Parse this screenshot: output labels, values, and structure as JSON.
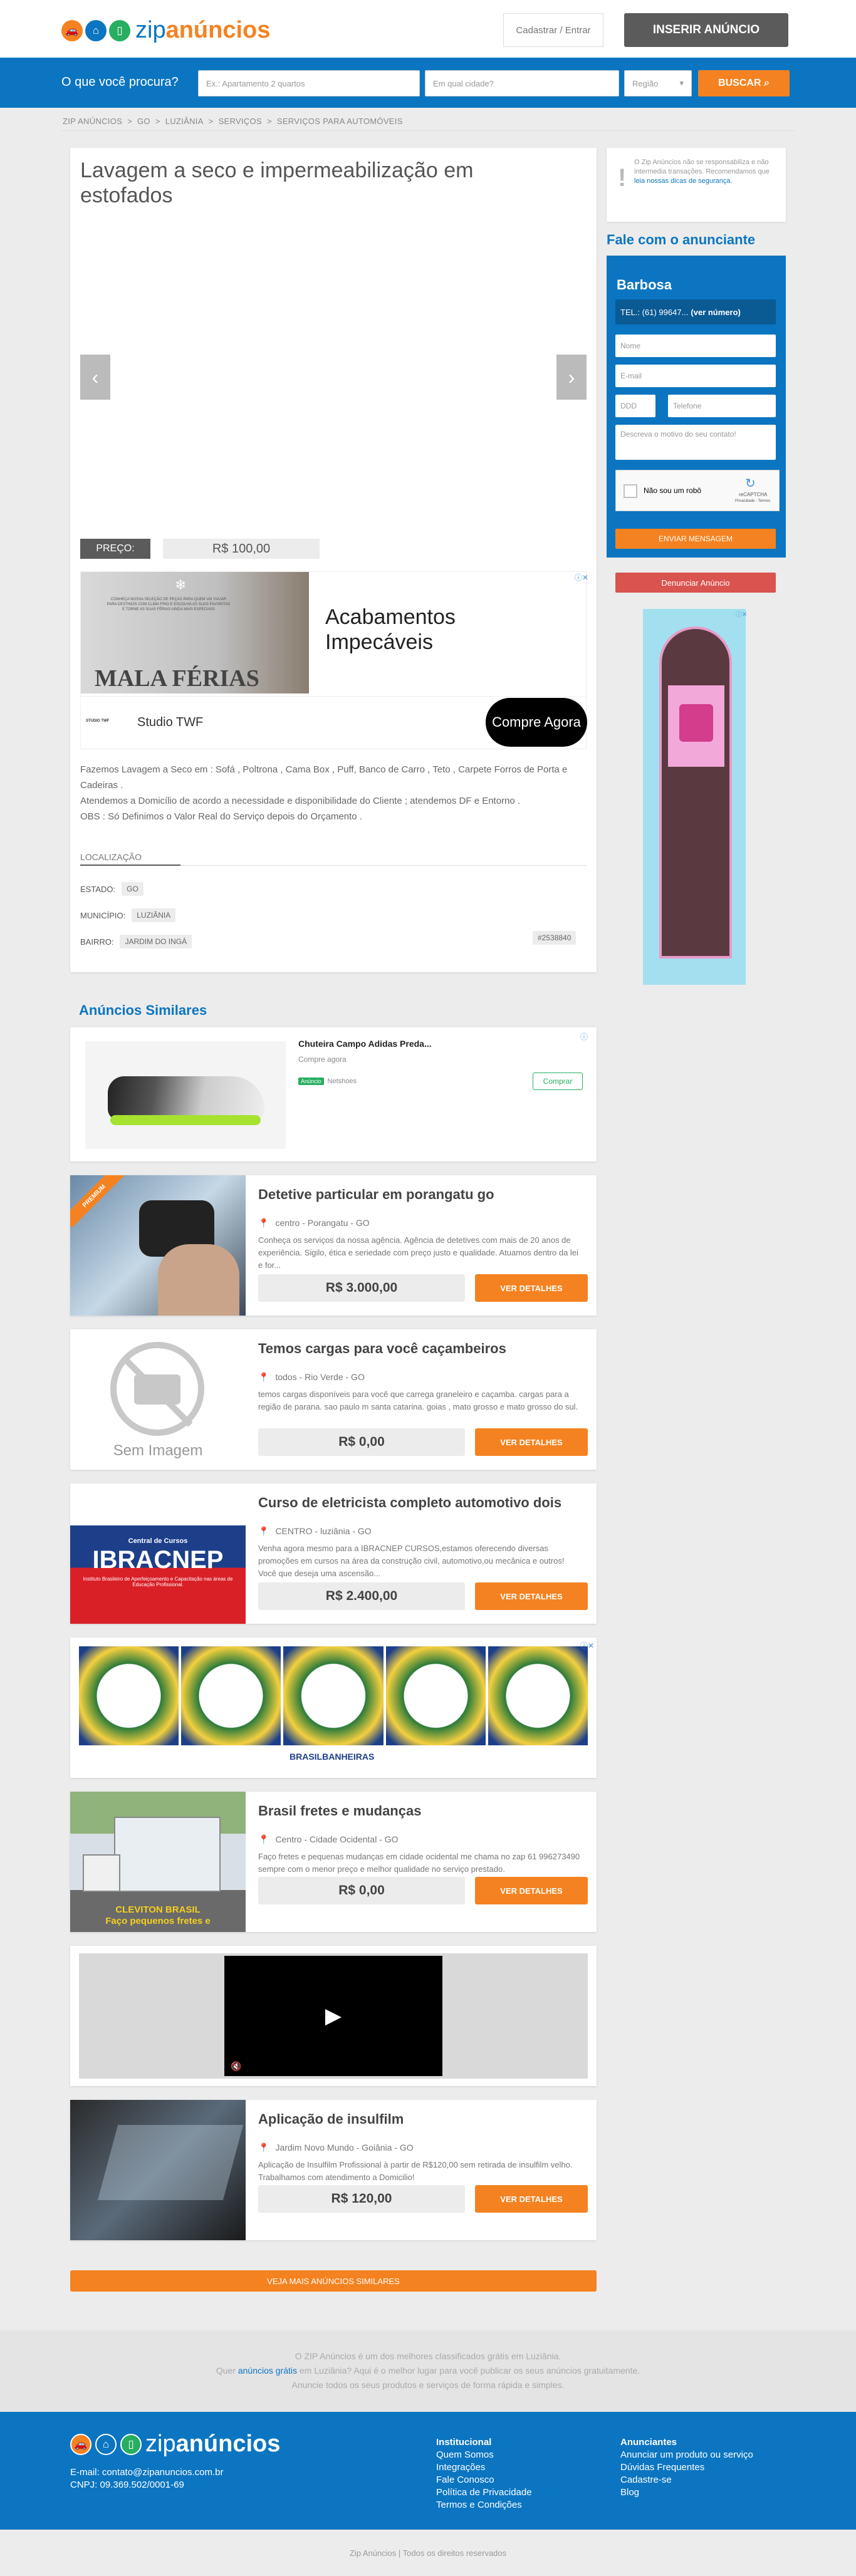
{
  "header": {
    "logo_text_a": "zip",
    "logo_text_b": "anúncios",
    "login": "Cadastrar / Entrar",
    "insert": "INSERIR ANÚNCIO"
  },
  "search": {
    "label": "O que você procura?",
    "query_placeholder": "Ex.: Apartamento 2 quartos",
    "city_placeholder": "Em qual cidade?",
    "region": "Região",
    "button": "BUSCAR"
  },
  "breadcrumb": [
    "ZIP ANÚNCIOS",
    ">",
    "GO",
    ">",
    "LUZIÂNIA",
    ">",
    "SERVIÇOS",
    ">",
    "SERVIÇOS PARA AUTOMÓVEIS"
  ],
  "listing": {
    "title": "Lavagem a seco e impermeabilização em estofados",
    "price_label": "PREÇO:",
    "price": "R$ 100,00",
    "desc": [
      "Fazemos Lavagem a Seco em : Sofá , Poltrona , Cama Box , Puff, Banco de Carro , Teto , Carpete Forros de Porta e Cadeiras .",
      "Atendemos a Domicílio de acordo a necessidade e disponibilidade do Cliente ; atendemos DF e Entorno .",
      "OBS : Só Definimos o Valor Real do Serviço depois do Orçamento ."
    ],
    "location_title": "LOCALIZAÇÃO",
    "estado_label": "ESTADO:",
    "estado": "GO",
    "municipio_label": "MUNICÍPIO:",
    "municipio": "LUZIÂNIA",
    "bairro_label": "BAIRRO:",
    "bairro": "JARDIM DO INGÁ",
    "code": "#2538840"
  },
  "ad1": {
    "big": "Acabamentos Impecáveis",
    "brand": "Studio TWF",
    "cta": "Compre Agora",
    "banner": "MALA FÉRIAS",
    "small": "CONHEÇA NOSSA SELEÇÃO DE PEÇAS PARA QUEM VAI VIAJAR PARA DESTINOS COM CLIMA FRIO E ESCOLHA AS SUAS FAVORITAS E TORNE AS SUAS FÉRIAS AINDA MAIS ESPECIAIS!",
    "logo": "STUDIO TWF"
  },
  "sidebar": {
    "notice_a": "O Zip Anúncios não se responsabiliza e não intermedia transações. Recomendamos que ",
    "notice_link": "leia nossas dicas de segurança",
    "notice_b": ".",
    "contact_title": "Fale com o anunciante",
    "seller": "Barbosa",
    "phone": "TEL.: (61) 99647...",
    "phone_more": "(ver número)",
    "name_ph": "Nome",
    "email_ph": "E-mail",
    "ddd_ph": "DDD",
    "tel_ph": "Telefone",
    "msg_ph": "Descreva o motivo do seu contato!",
    "robot": "Não sou um robô",
    "recaptcha": "reCAPTCHA",
    "recaptcha_sub": "Privacidade - Termos",
    "send": "ENVIAR MENSAGEM",
    "report": "Denunciar Anúncio"
  },
  "similar": {
    "title": "Anúncios Similares",
    "ad_shoe": {
      "title": "Chuteira Campo Adidas Preda...",
      "sub": "Compre agora",
      "badge": "Anúncio",
      "store": "Netshoes",
      "btn": "Comprar"
    },
    "items": [
      {
        "title": "Detetive particular em porangatu go",
        "loc": "centro - Porangatu - GO",
        "desc": "Conheça os serviços da nossa agência. Agência de detetives com mais de 20 anos de experiência. Sigilo, ética e seriedade com preço justo e qualidade. Atuamos dentro da lei e for...",
        "price": "R$ 3.000,00",
        "btn": "VER DETALHES",
        "ribbon": "PREMIUM"
      },
      {
        "title": "Temos cargas para você caçambeiros",
        "loc": "todos - Rio Verde - GO",
        "desc": "temos cargas disponíveis para você que carrega graneleiro e caçamba. cargas para a região de parana. sao paulo m santa catarina. goias , mato grosso e mato grosso do sul.",
        "price": "R$ 0,00",
        "btn": "VER DETALHES",
        "noimg": "Sem Imagem"
      },
      {
        "title": "Curso de eletricista completo automotivo dois",
        "loc": "CENTRO - luziânia - GO",
        "desc": "Venha agora mesmo para a IBRACNEP CURSOS,estamos oferecendo diversas promoções em cursos na área da construção civil, automotivo,ou mecânica e outros! Você que deseja uma ascensão...",
        "price": "R$ 2.400,00",
        "btn": "VER DETALHES",
        "img_top": "Central de Cursos",
        "img_big": "IBRACNEP",
        "img_sub": "Instituto Brasileiro de Aperfeiçoamento e Capacitação nas áreas de Educação Profissional."
      },
      {
        "title": "Brasil fretes e mudanças",
        "loc": "Centro - Cidade Ocidental - GO",
        "desc": "Faço fretes e pequenas mudanças em cidade ocidental me chama no zap 61 996273490 sempre com o menor preço e melhor qualidade no serviço prestado.",
        "price": "R$ 0,00",
        "btn": "VER DETALHES",
        "img_a": "CLEVITON BRASIL",
        "img_b": "Faço pequenos fretes e"
      },
      {
        "title": "Aplicação de insulfilm",
        "loc": "Jardim Novo Mundo - Goiânia - GO",
        "desc": "Aplicação de Insulfilm Profissional à partir de R$120,00 sem retirada de insulfilm velho. Trabalhamos com atendimento a Domicilio!",
        "price": "R$ 120,00",
        "btn": "VER DETALHES"
      }
    ],
    "banheiras_logo": "BRASILBANHEIRAS",
    "more": "VEJA MAIS ANÚNCIOS SIMILARES"
  },
  "seo": {
    "l1": "O ZIP Anúncios é um dos melhores classificados grátis em Luziânia.",
    "l2a": "Quer ",
    "l2link": "anúncios grátis",
    "l2b": " em Luziânia? Aqui é o melhor lugar para você publicar os seus anúncios gratuitamente.",
    "l3": "Anuncie todos os seus produtos e serviços de forma rápida e simples."
  },
  "footer": {
    "email": "E-mail: contato@zipanuncios.com.br",
    "cnpj": "CNPJ: 09.369.502/0001-69",
    "col1_title": "Institucional",
    "col1": [
      "Quem Somos",
      "Integrações",
      "Fale Conosco",
      "Política de Privacidade",
      "Termos e Condições"
    ],
    "col2_title": "Anunciantes",
    "col2": [
      "Anunciar um produto ou serviço",
      "Dúvidas Frequentes",
      "Cadastre-se",
      "Blog"
    ],
    "copyright": "Zip Anúncios | Todos os direitos reservados"
  },
  "colors": {
    "blue": "#0b75c1",
    "orange": "#f58220",
    "green": "#27ae60",
    "red": "#d9534f"
  }
}
